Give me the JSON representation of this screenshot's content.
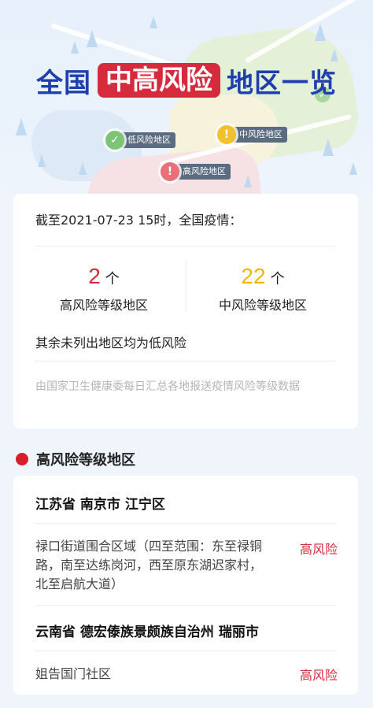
{
  "hero": {
    "title_left": "全国",
    "title_highlight": "中高风险",
    "title_right": "地区一览",
    "pins": {
      "low": "低风险地区",
      "mid": "中风险地区",
      "high": "高风险地区"
    }
  },
  "summary": {
    "as_of": "截至2021-07-23 15时，全国疫情：",
    "high": {
      "count": "2",
      "unit": "个",
      "label": "高风险等级地区"
    },
    "mid": {
      "count": "22",
      "unit": "个",
      "label": "中风险等级地区"
    },
    "rest_note": "其余未列出地区均为低风险",
    "source_note": "由国家卫生健康委每日汇总各地报送疫情风险等级数据"
  },
  "section": {
    "title": "高风险等级地区"
  },
  "high_risk_list": [
    {
      "region": "江苏省 南京市 江宁区",
      "area": "禄口街道围合区域（四至范围：东至禄铜路，南至达练岗河，西至原东湖迟家村，北至启航大道）",
      "level": "高风险"
    },
    {
      "region": "云南省 德宏傣族景颇族自治州 瑞丽市",
      "area": "姐告国门社区",
      "level": "高风险"
    }
  ],
  "colors": {
    "title_blue": "#1e3fae",
    "accent_red": "#d62b3c",
    "mid_yellow": "#f5b400",
    "low_green": "#7cc576"
  }
}
